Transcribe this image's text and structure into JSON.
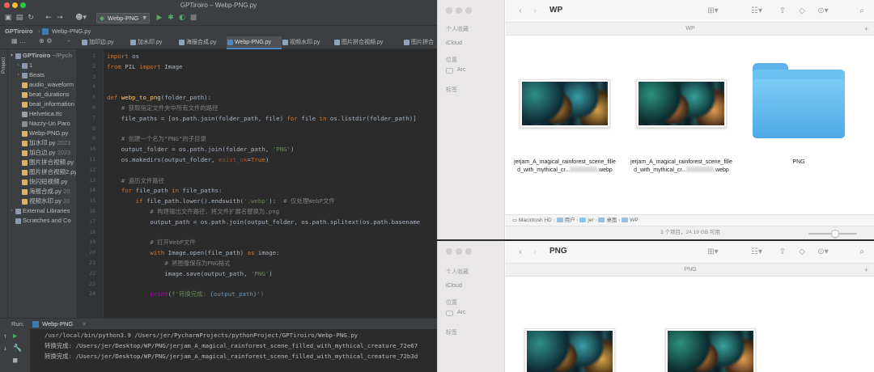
{
  "ide": {
    "window_title": "GPTiroiro – Webp-PNG.py",
    "run_config": "Webp-PNG",
    "breadcrumb": [
      "GPTiroiro",
      "Webp-PNG.py"
    ],
    "tabs": [
      "加印边.py",
      "加水印.py",
      "海报合成.py",
      "Webp-PNG.py",
      "视频水印.py",
      "图片拼合视频.py",
      "图片拼合"
    ],
    "active_tab_index": 3,
    "project_strip_label": "Project",
    "project_tree": [
      {
        "label": "GPTiroiro",
        "suffix": "~/Pych",
        "level": 0,
        "arrow": "▾",
        "kind": "folder",
        "bold": true
      },
      {
        "label": "1",
        "level": 1,
        "arrow": "›",
        "kind": "folder"
      },
      {
        "label": "Beats",
        "level": 1,
        "arrow": "›",
        "kind": "folder"
      },
      {
        "label": "audio_waveform",
        "level": 1,
        "kind": "py"
      },
      {
        "label": "beat_durations",
        "level": 1,
        "kind": "py"
      },
      {
        "label": "beat_information",
        "level": 1,
        "kind": "py"
      },
      {
        "label": "Helvetica.ttc",
        "level": 1,
        "kind": "font"
      },
      {
        "label": "Nazzy-Un Paro",
        "level": 1,
        "kind": "audio"
      },
      {
        "label": "Webp-PNG.py",
        "level": 1,
        "kind": "py"
      },
      {
        "label": "加水印.py",
        "suffix": "2023",
        "level": 1,
        "kind": "py"
      },
      {
        "label": "加白边.py",
        "suffix": "2023",
        "level": 1,
        "kind": "py"
      },
      {
        "label": "图片拼合视频.py",
        "level": 1,
        "kind": "py"
      },
      {
        "label": "图片拼合视频2.py",
        "level": 1,
        "kind": "py"
      },
      {
        "label": "快闪短视频.py",
        "level": 1,
        "kind": "py"
      },
      {
        "label": "海报合成.py",
        "suffix": "20",
        "level": 1,
        "kind": "py"
      },
      {
        "label": "视频水印.py",
        "suffix": "20",
        "level": 1,
        "kind": "py"
      },
      {
        "label": "External Libraries",
        "level": 0,
        "arrow": "›",
        "kind": "lib"
      },
      {
        "label": "Scratches and Co",
        "level": 0,
        "kind": "scratch"
      }
    ],
    "code": [
      {
        "ln": "1",
        "parts": [
          {
            "t": "import ",
            "c": "k"
          },
          {
            "t": "os"
          }
        ]
      },
      {
        "ln": "2",
        "parts": [
          {
            "t": "from ",
            "c": "k"
          },
          {
            "t": "PIL "
          },
          {
            "t": "import ",
            "c": "k"
          },
          {
            "t": "Image"
          }
        ]
      },
      {
        "ln": "3",
        "parts": []
      },
      {
        "ln": "4",
        "parts": []
      },
      {
        "ln": "5",
        "parts": [
          {
            "t": "def ",
            "c": "k"
          },
          {
            "t": "webp_to_png",
            "c": "f"
          },
          {
            "t": "(folder_path):"
          }
        ]
      },
      {
        "ln": "6",
        "parts": [
          {
            "t": "    # 获取指定文件夹中所有文件的路径",
            "c": "c"
          }
        ]
      },
      {
        "ln": "7",
        "parts": [
          {
            "t": "    file_paths = [os.path.join(folder_path, file) "
          },
          {
            "t": "for ",
            "c": "k"
          },
          {
            "t": "file "
          },
          {
            "t": "in ",
            "c": "k"
          },
          {
            "t": "os.listdir(folder_path)]"
          }
        ]
      },
      {
        "ln": "8",
        "parts": []
      },
      {
        "ln": "9",
        "parts": [
          {
            "t": "    # 创建一个名为\"PNG\"的子目录",
            "c": "c"
          }
        ]
      },
      {
        "ln": "10",
        "parts": [
          {
            "t": "    output_folder = os.path.join(folder_path, "
          },
          {
            "t": "'PNG'",
            "c": "s"
          },
          {
            "t": ")"
          }
        ]
      },
      {
        "ln": "11",
        "parts": [
          {
            "t": "    os.makedirs(output_folder, "
          },
          {
            "t": "exist_ok",
            "c": "p"
          },
          {
            "t": "="
          },
          {
            "t": "True",
            "c": "k"
          },
          {
            "t": ")"
          }
        ]
      },
      {
        "ln": "12",
        "parts": []
      },
      {
        "ln": "13",
        "parts": [
          {
            "t": "    # 遍历文件路径",
            "c": "c"
          }
        ]
      },
      {
        "ln": "14",
        "parts": [
          {
            "t": "    "
          },
          {
            "t": "for ",
            "c": "k"
          },
          {
            "t": "file_path "
          },
          {
            "t": "in ",
            "c": "k"
          },
          {
            "t": "file_paths:"
          }
        ]
      },
      {
        "ln": "15",
        "parts": [
          {
            "t": "        "
          },
          {
            "t": "if ",
            "c": "k"
          },
          {
            "t": "file_path.lower().endswith("
          },
          {
            "t": "'.webp'",
            "c": "s"
          },
          {
            "t": "):  "
          },
          {
            "t": "# 仅处理WebP文件",
            "c": "c"
          }
        ]
      },
      {
        "ln": "16",
        "parts": [
          {
            "t": "            # 构建输出文件路径，将文件扩展名替换为.png",
            "c": "c"
          }
        ]
      },
      {
        "ln": "17",
        "parts": [
          {
            "t": "            output_path = os.path.join(output_folder, os.path.splitext(os.path.basename"
          }
        ]
      },
      {
        "ln": "18",
        "parts": []
      },
      {
        "ln": "19",
        "parts": [
          {
            "t": "            # 打开WebP文件",
            "c": "c"
          }
        ]
      },
      {
        "ln": "20",
        "parts": [
          {
            "t": "            "
          },
          {
            "t": "with ",
            "c": "k"
          },
          {
            "t": "Image.open(file_path) "
          },
          {
            "t": "as ",
            "c": "k"
          },
          {
            "t": "image:"
          }
        ]
      },
      {
        "ln": "21",
        "parts": [
          {
            "t": "                # 将图像保存为PNG格式",
            "c": "c"
          }
        ]
      },
      {
        "ln": "22",
        "parts": [
          {
            "t": "                image.save(output_path, "
          },
          {
            "t": "'PNG'",
            "c": "s"
          },
          {
            "t": ")"
          }
        ]
      },
      {
        "ln": "23",
        "parts": []
      },
      {
        "ln": "24",
        "parts": [
          {
            "t": "            "
          },
          {
            "t": "print",
            "c": "m"
          },
          {
            "t": "("
          },
          {
            "t": "f'转换完成: ",
            "c": "s"
          },
          {
            "t": "{output_path}",
            "c": "n"
          },
          {
            "t": "')",
            "c": "s"
          }
        ]
      }
    ],
    "run": {
      "label": "Run:",
      "tab": "Webp-PNG",
      "lines": [
        "/usr/local/bin/python3.9 /Users/jer/PycharmProjects/pythonProject/GPTiroiro/Webp-PNG.py",
        "转换完成: /Users/jer/Desktop/WP/PNG/jerjam_A_magical_rainforest_scene_filled_with_mythical_creature_72e67",
        "转换完成: /Users/jer/Desktop/WP/PNG/jerjam_A_magical_rainforest_scene_filled_with_mythical_creature_72b3d"
      ]
    }
  },
  "finder_top": {
    "title": "WP",
    "header": "WP",
    "sidebar": {
      "section1": "个人收藏",
      "icloud": "iCloud",
      "section2": "位置",
      "item": "Arc",
      "section3": "标签"
    },
    "items": [
      {
        "line1": "jerjam_A_magical_rainforest_scene_fille",
        "line2": "d_with_mythical_cr...",
        "ext": ".webp"
      },
      {
        "line1": "jerjam_A_magical_rainforest_scene_fille",
        "line2": "d_with_mythical_cr...",
        "ext": ".webp"
      },
      {
        "line1": "PNG",
        "line2": "",
        "ext": ""
      }
    ],
    "path": [
      "Macintosh HD",
      "用户",
      "jer",
      "桌面",
      "WP"
    ],
    "status": "3 个项目，24.19 GB 可用"
  },
  "finder_bottom": {
    "title": "PNG",
    "header": "PNG",
    "sidebar": {
      "section1": "个人收藏",
      "icloud": "iCloud",
      "section2": "位置",
      "item": "Arc",
      "section3": "标签"
    }
  },
  "colors": {
    "ide_bg": "#2b2b2b",
    "ide_panel": "#3c3f41",
    "accent": "#4a88c7",
    "folder_blue": "#6cc2f3"
  }
}
